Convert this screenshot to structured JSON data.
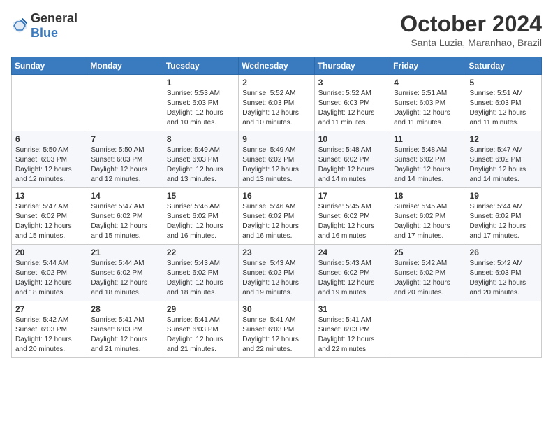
{
  "header": {
    "logo_general": "General",
    "logo_blue": "Blue",
    "month": "October 2024",
    "location": "Santa Luzia, Maranhao, Brazil"
  },
  "days_of_week": [
    "Sunday",
    "Monday",
    "Tuesday",
    "Wednesday",
    "Thursday",
    "Friday",
    "Saturday"
  ],
  "weeks": [
    [
      {
        "day": "",
        "info": ""
      },
      {
        "day": "",
        "info": ""
      },
      {
        "day": "1",
        "info": "Sunrise: 5:53 AM\nSunset: 6:03 PM\nDaylight: 12 hours and 10 minutes."
      },
      {
        "day": "2",
        "info": "Sunrise: 5:52 AM\nSunset: 6:03 PM\nDaylight: 12 hours and 10 minutes."
      },
      {
        "day": "3",
        "info": "Sunrise: 5:52 AM\nSunset: 6:03 PM\nDaylight: 12 hours and 11 minutes."
      },
      {
        "day": "4",
        "info": "Sunrise: 5:51 AM\nSunset: 6:03 PM\nDaylight: 12 hours and 11 minutes."
      },
      {
        "day": "5",
        "info": "Sunrise: 5:51 AM\nSunset: 6:03 PM\nDaylight: 12 hours and 11 minutes."
      }
    ],
    [
      {
        "day": "6",
        "info": "Sunrise: 5:50 AM\nSunset: 6:03 PM\nDaylight: 12 hours and 12 minutes."
      },
      {
        "day": "7",
        "info": "Sunrise: 5:50 AM\nSunset: 6:03 PM\nDaylight: 12 hours and 12 minutes."
      },
      {
        "day": "8",
        "info": "Sunrise: 5:49 AM\nSunset: 6:03 PM\nDaylight: 12 hours and 13 minutes."
      },
      {
        "day": "9",
        "info": "Sunrise: 5:49 AM\nSunset: 6:02 PM\nDaylight: 12 hours and 13 minutes."
      },
      {
        "day": "10",
        "info": "Sunrise: 5:48 AM\nSunset: 6:02 PM\nDaylight: 12 hours and 14 minutes."
      },
      {
        "day": "11",
        "info": "Sunrise: 5:48 AM\nSunset: 6:02 PM\nDaylight: 12 hours and 14 minutes."
      },
      {
        "day": "12",
        "info": "Sunrise: 5:47 AM\nSunset: 6:02 PM\nDaylight: 12 hours and 14 minutes."
      }
    ],
    [
      {
        "day": "13",
        "info": "Sunrise: 5:47 AM\nSunset: 6:02 PM\nDaylight: 12 hours and 15 minutes."
      },
      {
        "day": "14",
        "info": "Sunrise: 5:47 AM\nSunset: 6:02 PM\nDaylight: 12 hours and 15 minutes."
      },
      {
        "day": "15",
        "info": "Sunrise: 5:46 AM\nSunset: 6:02 PM\nDaylight: 12 hours and 16 minutes."
      },
      {
        "day": "16",
        "info": "Sunrise: 5:46 AM\nSunset: 6:02 PM\nDaylight: 12 hours and 16 minutes."
      },
      {
        "day": "17",
        "info": "Sunrise: 5:45 AM\nSunset: 6:02 PM\nDaylight: 12 hours and 16 minutes."
      },
      {
        "day": "18",
        "info": "Sunrise: 5:45 AM\nSunset: 6:02 PM\nDaylight: 12 hours and 17 minutes."
      },
      {
        "day": "19",
        "info": "Sunrise: 5:44 AM\nSunset: 6:02 PM\nDaylight: 12 hours and 17 minutes."
      }
    ],
    [
      {
        "day": "20",
        "info": "Sunrise: 5:44 AM\nSunset: 6:02 PM\nDaylight: 12 hours and 18 minutes."
      },
      {
        "day": "21",
        "info": "Sunrise: 5:44 AM\nSunset: 6:02 PM\nDaylight: 12 hours and 18 minutes."
      },
      {
        "day": "22",
        "info": "Sunrise: 5:43 AM\nSunset: 6:02 PM\nDaylight: 12 hours and 18 minutes."
      },
      {
        "day": "23",
        "info": "Sunrise: 5:43 AM\nSunset: 6:02 PM\nDaylight: 12 hours and 19 minutes."
      },
      {
        "day": "24",
        "info": "Sunrise: 5:43 AM\nSunset: 6:02 PM\nDaylight: 12 hours and 19 minutes."
      },
      {
        "day": "25",
        "info": "Sunrise: 5:42 AM\nSunset: 6:02 PM\nDaylight: 12 hours and 20 minutes."
      },
      {
        "day": "26",
        "info": "Sunrise: 5:42 AM\nSunset: 6:03 PM\nDaylight: 12 hours and 20 minutes."
      }
    ],
    [
      {
        "day": "27",
        "info": "Sunrise: 5:42 AM\nSunset: 6:03 PM\nDaylight: 12 hours and 20 minutes."
      },
      {
        "day": "28",
        "info": "Sunrise: 5:41 AM\nSunset: 6:03 PM\nDaylight: 12 hours and 21 minutes."
      },
      {
        "day": "29",
        "info": "Sunrise: 5:41 AM\nSunset: 6:03 PM\nDaylight: 12 hours and 21 minutes."
      },
      {
        "day": "30",
        "info": "Sunrise: 5:41 AM\nSunset: 6:03 PM\nDaylight: 12 hours and 22 minutes."
      },
      {
        "day": "31",
        "info": "Sunrise: 5:41 AM\nSunset: 6:03 PM\nDaylight: 12 hours and 22 minutes."
      },
      {
        "day": "",
        "info": ""
      },
      {
        "day": "",
        "info": ""
      }
    ]
  ]
}
